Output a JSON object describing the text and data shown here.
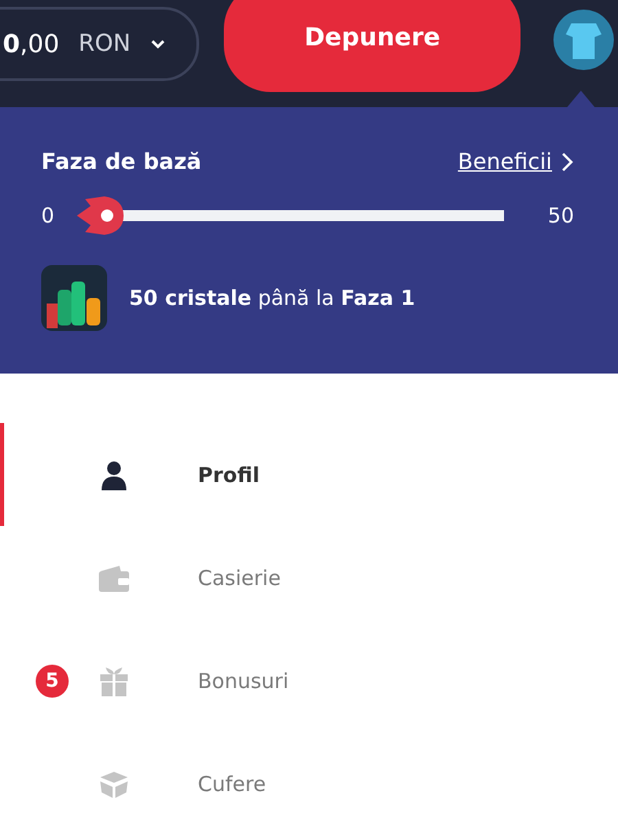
{
  "header": {
    "balance": "**0**,00",
    "currency": "RON",
    "deposit_button": "Depunere"
  },
  "level_panel": {
    "title": "Faza de bază",
    "benefits_link": "Beneficii",
    "progress": {
      "min": "0",
      "max": "50",
      "level": 0
    },
    "message": "**50 cristale** până la **Faza 1**"
  },
  "menu": [
    {
      "label": "Profil",
      "selected": true
    },
    {
      "label": "Casierie",
      "selected": false
    },
    {
      "label": "Bonusuri",
      "selected": false,
      "badge": "5"
    },
    {
      "label": "Cufere",
      "selected": false
    }
  ]
}
